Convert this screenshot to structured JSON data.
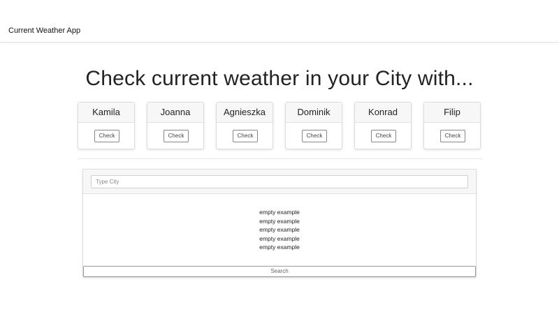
{
  "app": {
    "title": "Current Weather App"
  },
  "main": {
    "heading": "Check current weather in your City with..."
  },
  "people": [
    {
      "name": "Kamila",
      "button_label": "Check"
    },
    {
      "name": "Joanna",
      "button_label": "Check"
    },
    {
      "name": "Agnieszka",
      "button_label": "Check"
    },
    {
      "name": "Dominik",
      "button_label": "Check"
    },
    {
      "name": "Konrad",
      "button_label": "Check"
    },
    {
      "name": "Filip",
      "button_label": "Check"
    }
  ],
  "search": {
    "placeholder": "Type City",
    "value": "",
    "results": [
      "empty example",
      "empty example",
      "empty example",
      "empty example",
      "empty example"
    ],
    "button_label": "Search"
  }
}
